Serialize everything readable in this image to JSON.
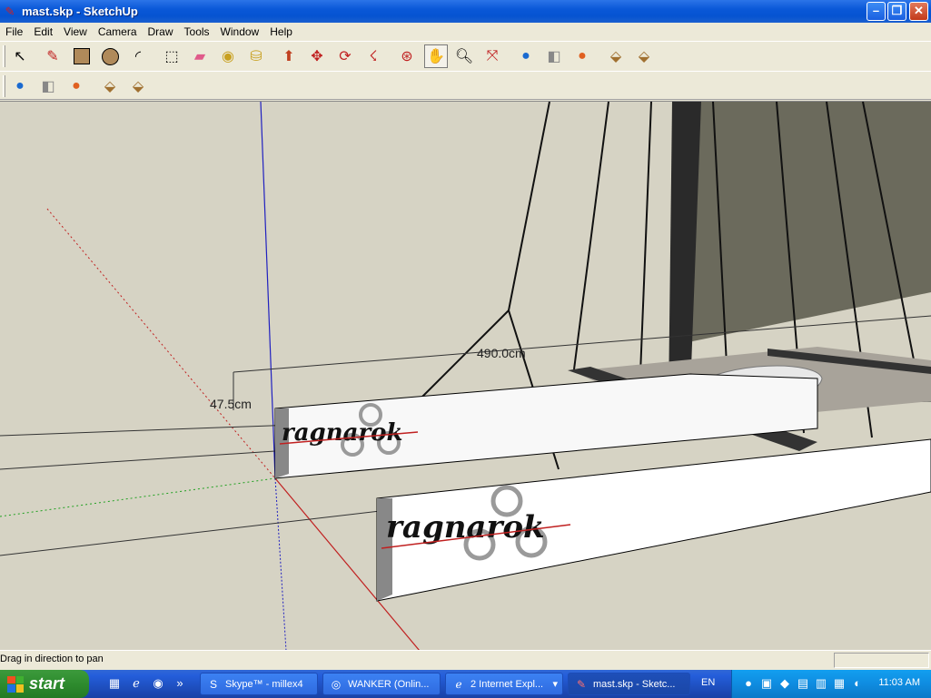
{
  "window": {
    "title": "mast.skp - SketchUp",
    "app_icon": "sketchup-pencil-icon",
    "buttons": [
      "minimize",
      "maximize",
      "close"
    ]
  },
  "menu": [
    "File",
    "Edit",
    "View",
    "Camera",
    "Draw",
    "Tools",
    "Window",
    "Help"
  ],
  "toolbar_main": [
    "select-icon",
    "pencil-icon",
    "rectangle-icon",
    "circle-icon",
    "arc-icon",
    "make-component-icon",
    "eraser-icon",
    "tape-measure-icon",
    "paint-bucket-icon",
    "push-pull-icon",
    "move-icon",
    "rotate-icon",
    "follow-me-icon",
    "orbit-icon",
    "pan-icon",
    "zoom-icon",
    "zoom-extents-icon",
    "get-models-icon",
    "share-model-icon",
    "google-earth-icon",
    "get-component-icon",
    "share-component-icon"
  ],
  "toolbar_second": [
    "get-models-icon",
    "share-model-icon",
    "google-earth-icon",
    "get-component-icon",
    "share-component-icon"
  ],
  "viewport": {
    "dimension_length": "490.0cm",
    "dimension_height": "47.5cm",
    "hull_text": "ragnarok"
  },
  "status": {
    "message": "Drag in direction to pan"
  },
  "taskbar": {
    "start_label": "start",
    "tasks": [
      {
        "label": "Skype™ - millex4",
        "icon": "skype-icon"
      },
      {
        "label": "WANKER  (Onlin...",
        "icon": "chat-icon"
      },
      {
        "label": "2 Internet Expl...",
        "icon": "ie-icon"
      },
      {
        "label": "mast.skp - Sketc...",
        "icon": "sketchup-icon"
      }
    ],
    "language": "EN",
    "clock": "11:03 AM"
  }
}
